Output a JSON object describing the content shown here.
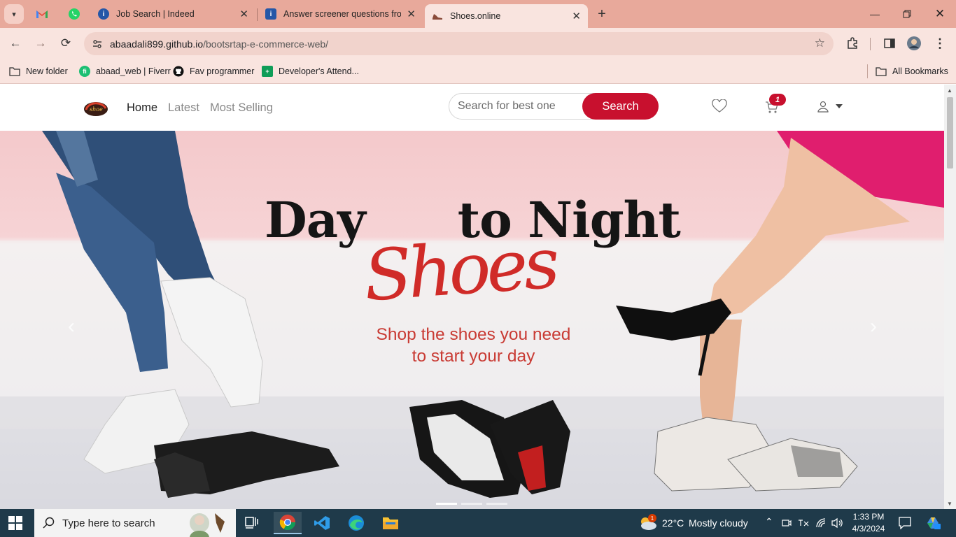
{
  "browser": {
    "tabs": [
      {
        "title": "Job Search | Indeed",
        "favicon": "indeed-icon"
      },
      {
        "title": "Answer screener questions from",
        "favicon": "indeed-icon"
      },
      {
        "title": "Shoes.online",
        "favicon": "shoe-icon",
        "active": true
      }
    ],
    "pinned": [
      "gmail-icon",
      "whatsapp-icon"
    ],
    "address": {
      "host": "abaadali899.github.io",
      "path": "/bootsrtap-e-commerce-web/"
    },
    "bookmarks": [
      {
        "label": "New folder",
        "icon": "folder-icon"
      },
      {
        "label": "abaad_web | Fiverr",
        "icon": "fiverr-icon"
      },
      {
        "label": "Fav programmer",
        "icon": "github-icon"
      },
      {
        "label": "Developer's Attend...",
        "icon": "sheets-icon"
      }
    ],
    "all_bookmarks": "All Bookmarks"
  },
  "site": {
    "nav": [
      {
        "label": "Home",
        "active": true
      },
      {
        "label": "Latest"
      },
      {
        "label": "Most Selling"
      }
    ],
    "search": {
      "placeholder": "Search for best one",
      "button": "Search"
    },
    "cart_count": "1",
    "accent": "#c8102e"
  },
  "hero": {
    "title_left": "Day",
    "title_right": "to Night",
    "script": "Shoes",
    "subtitle_line1": "Shop the shoes you need",
    "subtitle_line2": "to  start your day",
    "slides": 3,
    "active_slide": 1
  },
  "taskbar": {
    "search_placeholder": "Type here to search",
    "weather": {
      "temp": "22°C",
      "desc": "Mostly cloudy",
      "badge": "1"
    },
    "time": "1:33 PM",
    "date": "4/3/2024"
  }
}
